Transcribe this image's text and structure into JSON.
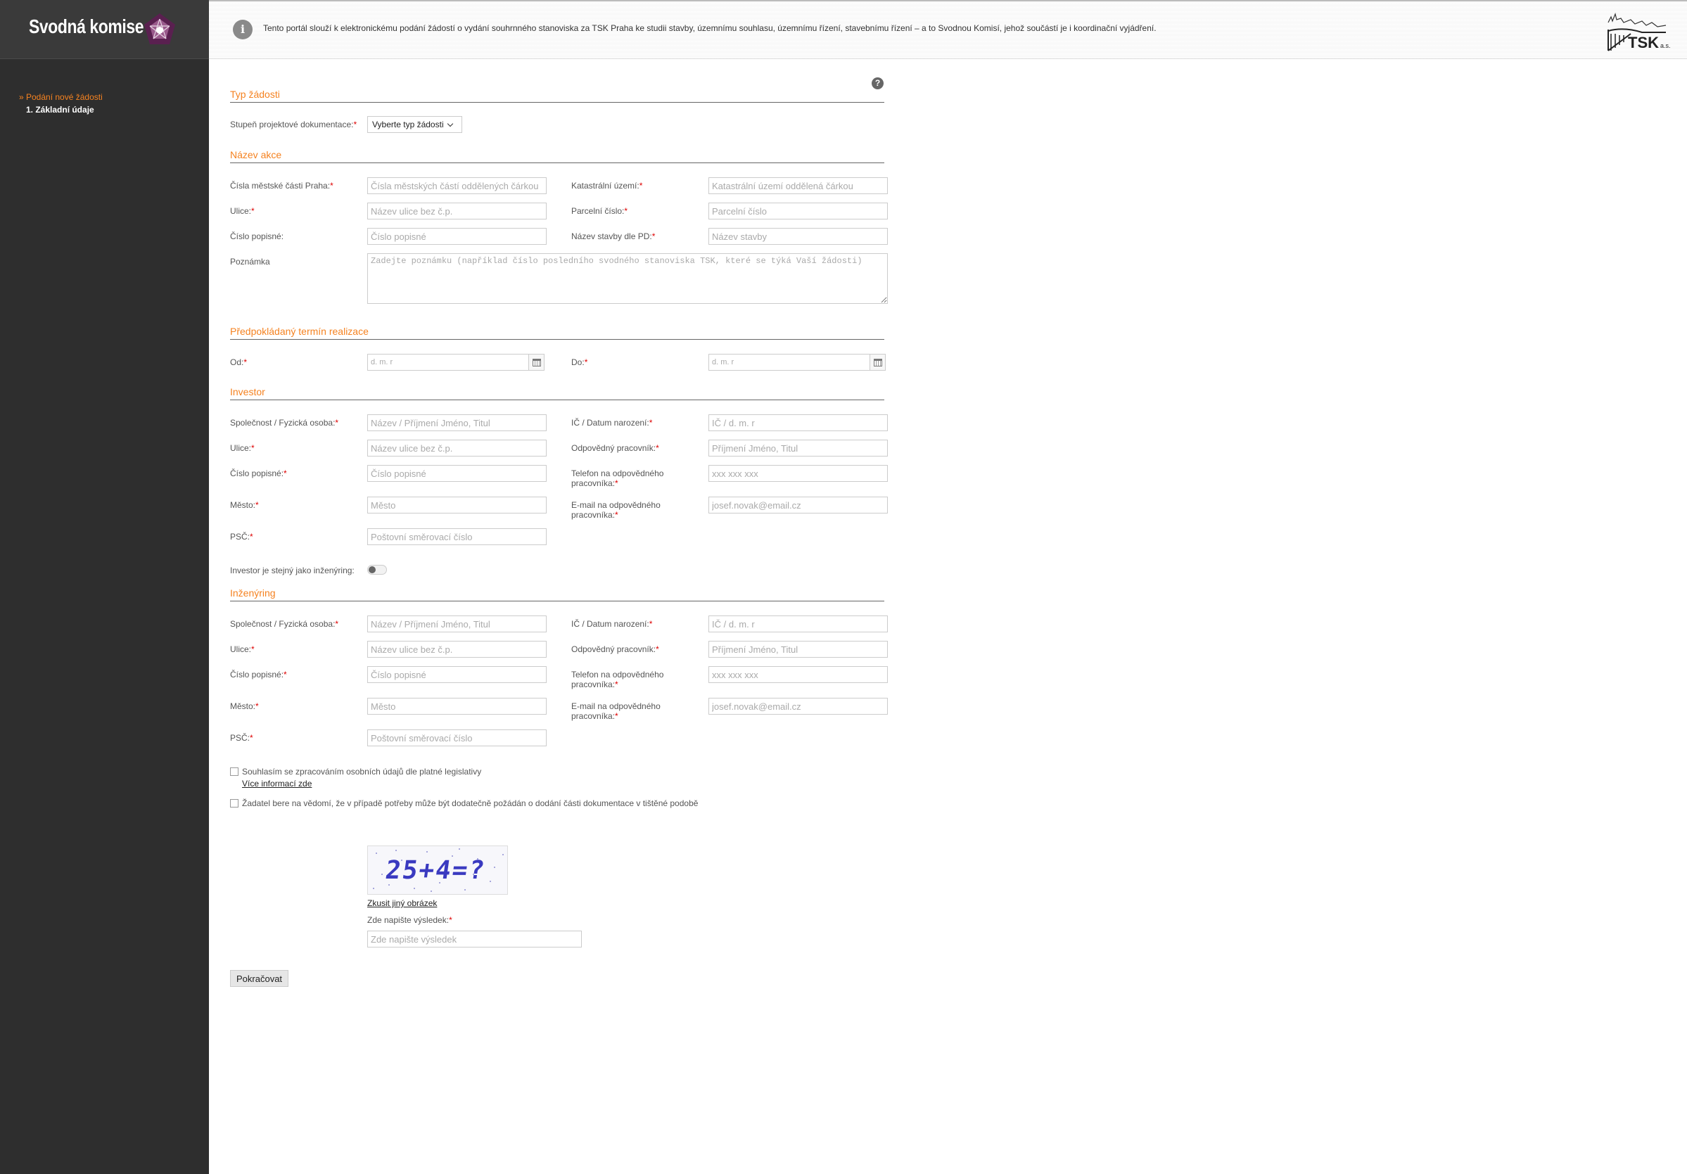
{
  "brand": {
    "title": "Svodná komise"
  },
  "nav": {
    "active": "» Podání nové žádosti",
    "sub": "1. Základní údaje"
  },
  "info": {
    "text": "Tento portál slouží k elektronickému podání žádostí o vydání souhrnného stanoviska za TSK Praha ke studii stavby, územnímu souhlasu, územnímu řízení, stavebnímu řízení – a to Svodnou Komisí, jehož součástí je i koordinační vyjádření."
  },
  "tsk": {
    "label": "TSK",
    "suffix": "a.s."
  },
  "sections": {
    "typ": "Typ žádosti",
    "nazev": "Název akce",
    "termin": "Předpokládaný termín realizace",
    "investor": "Investor",
    "inzenyring": "Inženýring"
  },
  "typ": {
    "label": "Stupeň projektové dokumentace:",
    "select_value": "Vyberte typ žádosti"
  },
  "nazev": {
    "casti_label": "Čísla městské části Praha:",
    "casti_ph": "Čísla městských částí oddělených čárkou",
    "katastr_label": "Katastrální území:",
    "katastr_ph": "Katastrální území oddělená čárkou",
    "ulice_label": "Ulice:",
    "ulice_ph": "Název ulice bez č.p.",
    "parcela_label": "Parcelní číslo:",
    "parcela_ph": "Parcelní číslo",
    "cp_label": "Číslo popisné:",
    "cp_ph": "Číslo popisné",
    "stavba_label": "Název stavby dle PD:",
    "stavba_ph": "Název stavby",
    "pozn_label": "Poznámka",
    "pozn_ph": "Zadejte poznámku (například číslo posledního svodného stanoviska TSK, které se týká Vaší žádosti)"
  },
  "termin": {
    "od_label": "Od:",
    "do_label": "Do:",
    "date_ph": "d. m. r"
  },
  "investor": {
    "spol_label": "Společnost / Fyzická osoba:",
    "spol_ph": "Název / Příjmení Jméno, Titul",
    "ic_label": "IČ / Datum narození:",
    "ic_ph": "IČ / d. m. r",
    "ulice_label": "Ulice:",
    "ulice_ph": "Název ulice bez č.p.",
    "prac_label": "Odpovědný pracovník:",
    "prac_ph": "Příjmení Jméno, Titul",
    "cp_label": "Číslo popisné:",
    "cp_ph": "Číslo popisné",
    "tel_label_1": "Telefon na odpovědného",
    "tel_label_2": "pracovníka:",
    "tel_ph": "xxx xxx xxx",
    "mesto_label": "Město:",
    "mesto_ph": "Město",
    "email_label_1": "E-mail na odpovědného",
    "email_label_2": "pracovníka:",
    "email_ph": "josef.novak@email.cz",
    "psc_label": "PSČ:",
    "psc_ph": "Poštovní směrovací číslo",
    "same_label": "Investor je stejný jako inženýring:"
  },
  "inzenyring": {
    "spol_label": "Společnost / Fyzická osoba:",
    "spol_ph": "Název / Příjmení Jméno, Titul",
    "ic_label": "IČ / Datum narození:",
    "ic_ph": "IČ / d. m. r",
    "ulice_label": "Ulice:",
    "ulice_ph": "Název ulice bez č.p.",
    "prac_label": "Odpovědný pracovník:",
    "prac_ph": "Příjmení Jméno, Titul",
    "cp_label": "Číslo popisné:",
    "cp_ph": "Číslo popisné",
    "tel_label_1": "Telefon na odpovědného",
    "tel_label_2": "pracovníka:",
    "tel_ph": "xxx xxx xxx",
    "mesto_label": "Město:",
    "mesto_ph": "Město",
    "email_label_1": "E-mail na odpovědného",
    "email_label_2": "pracovníka:",
    "email_ph": "josef.novak@email.cz",
    "psc_label": "PSČ:",
    "psc_ph": "Poštovní směrovací číslo"
  },
  "consent": {
    "gdpr": "Souhlasím se zpracováním osobních údajů dle platné legislativy",
    "more": "Více informací zde",
    "print": "Žadatel bere na vědomí, že v případě potřeby může být dodatečně požádán o dodání části dokumentace v tištěné podobě"
  },
  "captcha": {
    "image_text": "25+4=?",
    "retry": "Zkusit jiný obrázek",
    "label": "Zde napište výsledek:",
    "ph": "Zde napište výsledek"
  },
  "submit": {
    "label": "Pokračovat"
  },
  "colors": {
    "accent": "#f58220",
    "sidebar": "#2e2e2e",
    "brand_purple": "#6b2a5e"
  }
}
